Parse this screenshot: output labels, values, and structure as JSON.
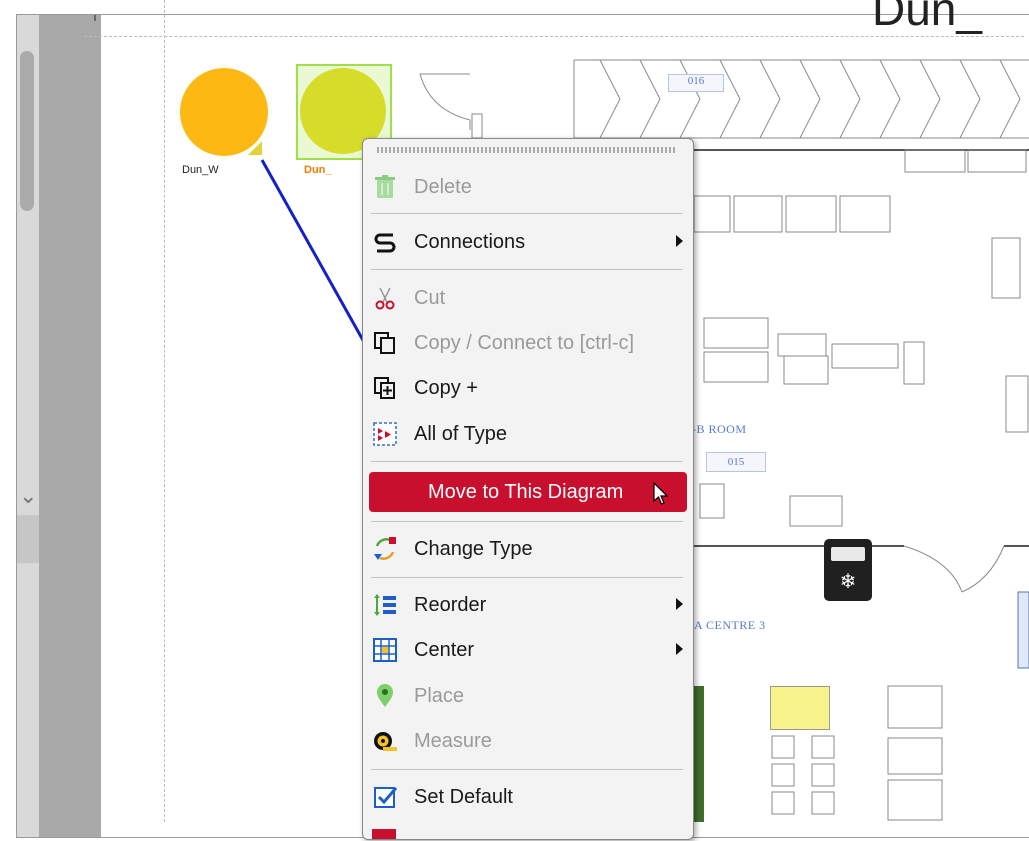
{
  "canvas": {
    "title": "Dun_",
    "nodes": [
      {
        "label": "Dun_W",
        "color": "#fdb813"
      },
      {
        "label": "Dun_",
        "color": "#d7dc2a",
        "selected": true
      }
    ],
    "connection_color": "#1420c8",
    "rooms": [
      {
        "name": "-B ROOM",
        "number": "015"
      },
      {
        "name": "A CENTRE 3"
      }
    ],
    "top_number": "016"
  },
  "context_menu": {
    "items": [
      {
        "label": "Delete",
        "icon": "trash-icon",
        "disabled": true
      },
      {
        "label": "Connections",
        "icon": "connections-icon",
        "submenu": true
      },
      {
        "label": "Cut",
        "icon": "scissors-icon",
        "disabled": true
      },
      {
        "label": "Copy / Connect to [ctrl-c]",
        "icon": "copy-icon",
        "disabled": true
      },
      {
        "label": "Copy +",
        "icon": "copy-plus-icon"
      },
      {
        "label": "All of Type",
        "icon": "all-of-type-icon"
      },
      {
        "label": "Move to This Diagram",
        "highlighted": true
      },
      {
        "label": "Change Type",
        "icon": "change-type-icon"
      },
      {
        "label": "Reorder",
        "icon": "reorder-icon",
        "submenu": true
      },
      {
        "label": "Center",
        "icon": "center-icon",
        "submenu": true
      },
      {
        "label": "Place",
        "icon": "map-pin-icon",
        "disabled": true
      },
      {
        "label": "Measure",
        "icon": "measure-icon",
        "disabled": true
      },
      {
        "label": "Set Default",
        "icon": "set-default-icon"
      }
    ],
    "highlight_color": "#c8102e"
  }
}
